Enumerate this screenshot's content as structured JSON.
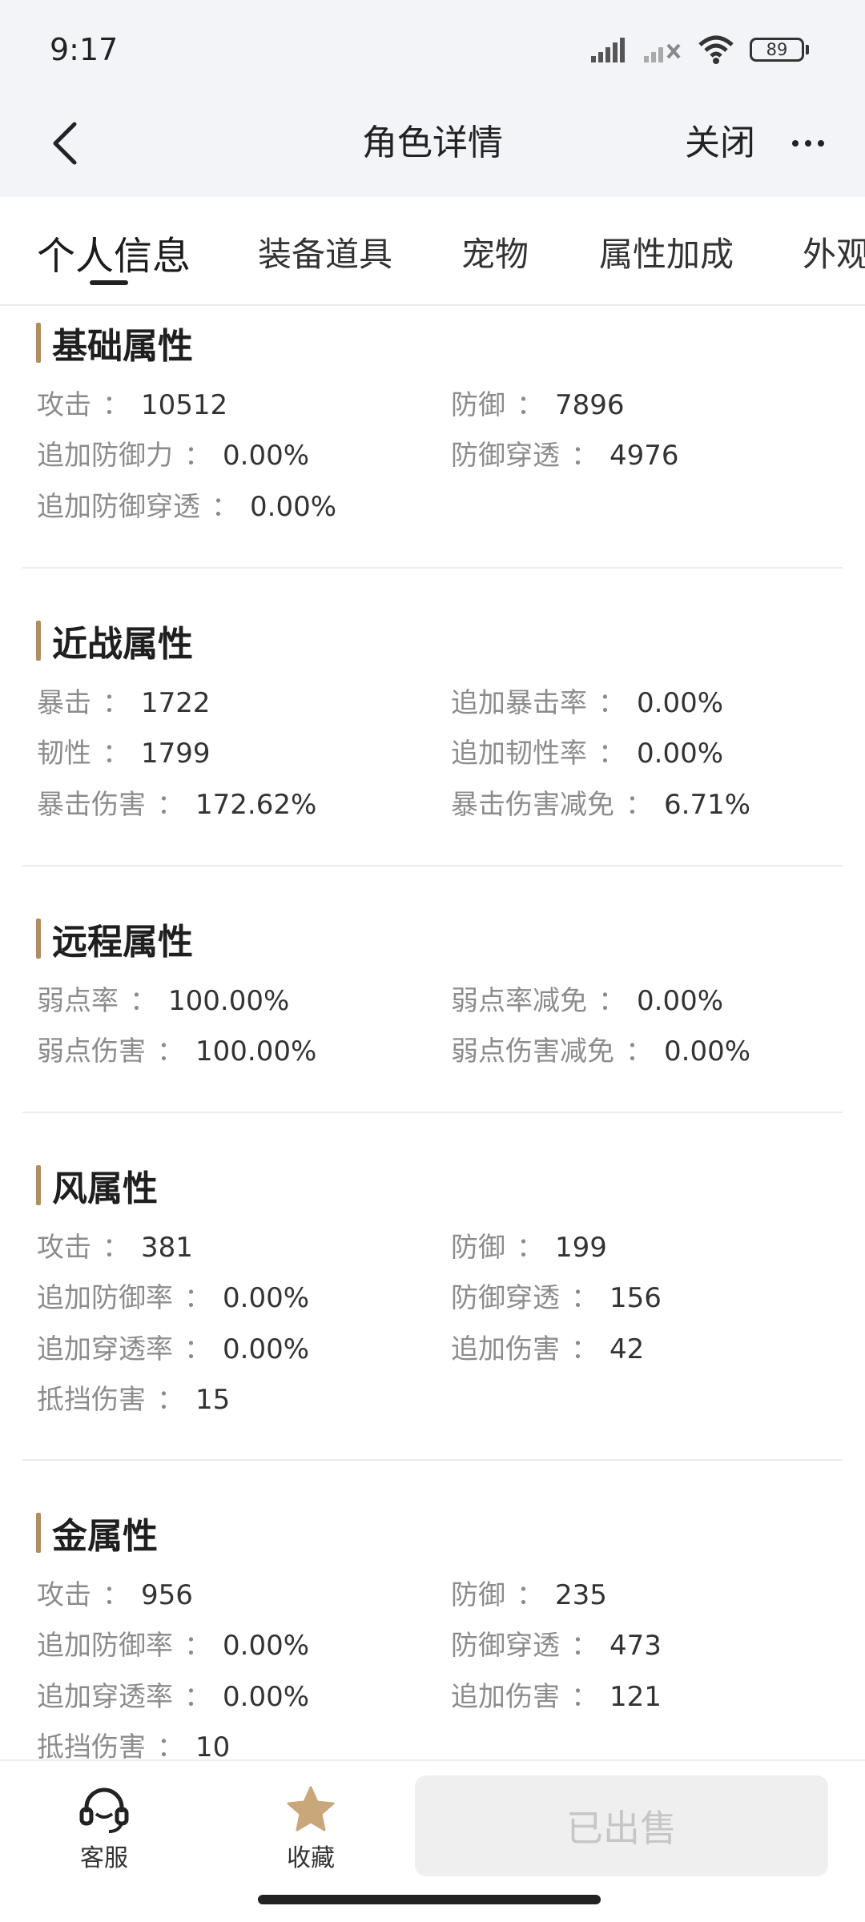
{
  "status_bar": {
    "time": "9:17",
    "battery": "89"
  },
  "nav": {
    "title": "角色详情",
    "close_label": "关闭"
  },
  "tabs": [
    {
      "label": "个人信息"
    },
    {
      "label": "装备道具"
    },
    {
      "label": "宠物"
    },
    {
      "label": "属性加成"
    },
    {
      "label": "外观"
    }
  ],
  "sections": {
    "basic": {
      "title": "基础属性",
      "rows": [
        {
          "label": "攻击",
          "value": "10512"
        },
        {
          "label": "防御",
          "value": "7896"
        },
        {
          "label": "追加防御力",
          "value": "0.00%"
        },
        {
          "label": "防御穿透",
          "value": "4976"
        },
        {
          "label": "追加防御穿透",
          "value": "0.00%"
        }
      ]
    },
    "melee": {
      "title": "近战属性",
      "rows": [
        {
          "label": "暴击",
          "value": "1722"
        },
        {
          "label": "追加暴击率",
          "value": "0.00%"
        },
        {
          "label": "韧性",
          "value": "1799"
        },
        {
          "label": "追加韧性率",
          "value": "0.00%"
        },
        {
          "label": "暴击伤害",
          "value": "172.62%"
        },
        {
          "label": "暴击伤害减免",
          "value": "6.71%"
        }
      ]
    },
    "ranged": {
      "title": "远程属性",
      "rows": [
        {
          "label": "弱点率",
          "value": "100.00%"
        },
        {
          "label": "弱点率减免",
          "value": "0.00%"
        },
        {
          "label": "弱点伤害",
          "value": "100.00%"
        },
        {
          "label": "弱点伤害减免",
          "value": "0.00%"
        }
      ]
    },
    "wind": {
      "title": "风属性",
      "rows": [
        {
          "label": "攻击",
          "value": "381"
        },
        {
          "label": "防御",
          "value": "199"
        },
        {
          "label": "追加防御率",
          "value": "0.00%"
        },
        {
          "label": "防御穿透",
          "value": "156"
        },
        {
          "label": "追加穿透率",
          "value": "0.00%"
        },
        {
          "label": "追加伤害",
          "value": "42"
        },
        {
          "label": "抵挡伤害",
          "value": "15"
        }
      ]
    },
    "metal": {
      "title": "金属性",
      "rows": [
        {
          "label": "攻击",
          "value": "956"
        },
        {
          "label": "防御",
          "value": "235"
        },
        {
          "label": "追加防御率",
          "value": "0.00%"
        },
        {
          "label": "防御穿透",
          "value": "473"
        },
        {
          "label": "追加穿透率",
          "value": "0.00%"
        },
        {
          "label": "追加伤害",
          "value": "121"
        },
        {
          "label": "抵挡伤害",
          "value": "10"
        }
      ]
    }
  },
  "separator": "：",
  "bottom": {
    "service_label": "客服",
    "favorite_label": "收藏",
    "sold_label": "已出售"
  },
  "colors": {
    "accent_bar": "#b08c5f",
    "favorite_star": "#c9a77a"
  }
}
